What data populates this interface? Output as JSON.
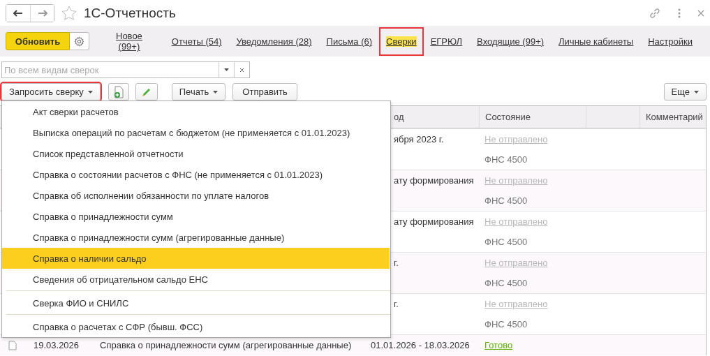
{
  "window": {
    "title": "1С-Отчетность"
  },
  "refresh_button": {
    "label": "Обновить"
  },
  "nav_links": [
    {
      "label": "Новое\n(99+)",
      "selected": false,
      "highlighted": false
    },
    {
      "label": "Отчеты (54)",
      "selected": false,
      "highlighted": false
    },
    {
      "label": "Уведомления (28)",
      "selected": false,
      "highlighted": false
    },
    {
      "label": "Письма (6)",
      "selected": false,
      "highlighted": false
    },
    {
      "label": "Сверки",
      "selected": true,
      "highlighted": true
    },
    {
      "label": "ЕГРЮЛ",
      "selected": false,
      "highlighted": false
    },
    {
      "label": "Входящие (99+)",
      "selected": false,
      "highlighted": false
    },
    {
      "label": "Личные кабинеты",
      "selected": false,
      "highlighted": false
    },
    {
      "label": "Настройки",
      "selected": false,
      "highlighted": false
    }
  ],
  "filter": {
    "placeholder": "По всем видам сверок"
  },
  "toolbar": {
    "request_button": {
      "label": "Запросить сверку",
      "highlighted": true
    },
    "print_button": "Печать",
    "send_button": "Отправить",
    "more_button": "Еще"
  },
  "table": {
    "columns": [
      {
        "label": "од"
      },
      {
        "label": "Состояние"
      },
      {},
      {
        "label": "Комментарий"
      }
    ],
    "rows": [
      {
        "period": "ября 2023 г.",
        "status": "Не отправлено",
        "ready": false,
        "recipient": "ФНС 4500"
      },
      {
        "period": "ату формирования",
        "status": "Не отправлено",
        "ready": false,
        "recipient": "ФНС 4500"
      },
      {
        "period": "ату формирования",
        "status": "Не отправлено",
        "ready": false,
        "recipient": "ФНС 4500"
      },
      {
        "period": "г.",
        "status": "Не отправлено",
        "ready": false,
        "recipient": "ФНС 4500"
      },
      {
        "period": "г.",
        "status": "Не отправлено",
        "ready": false,
        "recipient": "ФНС 4500"
      },
      {
        "date": "19.03.2026",
        "name": "Справка о принадлежности сумм (агрегированные данные)",
        "period": "01.01.2026 - 18.03.2026",
        "status": "Готово",
        "ready": true
      }
    ]
  },
  "request_menu": {
    "groups": [
      [
        {
          "label": "Акт сверки расчетов",
          "selected": false
        },
        {
          "label": "Выписка операций по расчетам с бюджетом (не применяется с 01.01.2023)",
          "selected": false
        },
        {
          "label": "Список представленной отчетности",
          "selected": false
        },
        {
          "label": "Справка о состоянии расчетов с ФНС (не применяется с 01.01.2023)",
          "selected": false
        },
        {
          "label": "Справка об исполнении обязанности по уплате налогов",
          "selected": false
        },
        {
          "label": "Справка о принадлежности сумм",
          "selected": false
        },
        {
          "label": "Справка о принадлежности сумм (агрегированные данные)",
          "selected": false
        },
        {
          "label": "Справка о наличии сальдо",
          "selected": true
        },
        {
          "label": "Сведения об отрицательном сальдо ЕНС",
          "selected": false
        }
      ],
      [
        {
          "label": "Сверка ФИО и СНИЛС",
          "selected": false
        }
      ],
      [
        {
          "label": "Справка о расчетах с СФР (бывш. ФСС)",
          "selected": false
        }
      ]
    ]
  }
}
